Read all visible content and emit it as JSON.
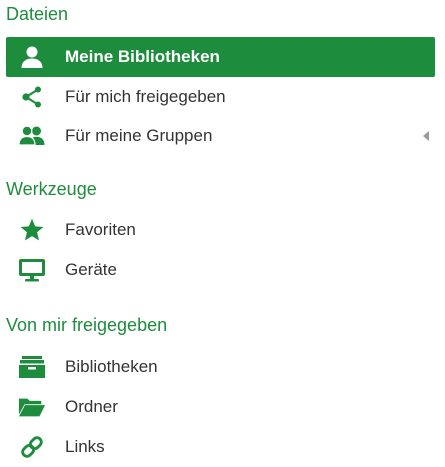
{
  "colors": {
    "accent": "#1d8c3d",
    "active_bg": "#1d8c3d",
    "text": "#333333",
    "active_text": "#ffffff",
    "caret": "#999999"
  },
  "sections": {
    "files": {
      "title": "Dateien",
      "items": [
        {
          "label": "Meine Bibliotheken",
          "icon": "user-icon",
          "active": true
        },
        {
          "label": "Für mich freigegeben",
          "icon": "share-icon",
          "active": false
        },
        {
          "label": "Für meine Gruppen",
          "icon": "group-icon",
          "active": false,
          "expandable": true,
          "expanded": false
        }
      ]
    },
    "tools": {
      "title": "Werkzeuge",
      "items": [
        {
          "label": "Favoriten",
          "icon": "star-icon"
        },
        {
          "label": "Geräte",
          "icon": "monitor-icon"
        }
      ]
    },
    "shared_by_me": {
      "title": "Von mir freigegeben",
      "items": [
        {
          "label": "Bibliotheken",
          "icon": "library-archive-icon"
        },
        {
          "label": "Ordner",
          "icon": "folder-open-icon"
        },
        {
          "label": "Links",
          "icon": "link-icon"
        }
      ]
    }
  }
}
